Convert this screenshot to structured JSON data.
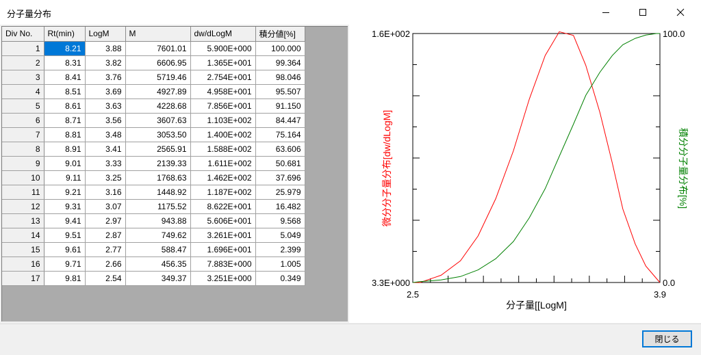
{
  "window": {
    "title": "分子量分布",
    "minimize_icon": "minimize-icon",
    "maximize_icon": "maximize-icon",
    "close_icon": "close-icon"
  },
  "table": {
    "columns": [
      "Div No.",
      "Rt(min)",
      "LogM",
      "M",
      "dw/dLogM",
      "積分値[%]"
    ],
    "rows": [
      [
        "1",
        "8.21",
        "3.88",
        "7601.01",
        "5.900E+000",
        "100.000"
      ],
      [
        "2",
        "8.31",
        "3.82",
        "6606.95",
        "1.365E+001",
        "99.364"
      ],
      [
        "3",
        "8.41",
        "3.76",
        "5719.46",
        "2.754E+001",
        "98.046"
      ],
      [
        "4",
        "8.51",
        "3.69",
        "4927.89",
        "4.958E+001",
        "95.507"
      ],
      [
        "5",
        "8.61",
        "3.63",
        "4228.68",
        "7.856E+001",
        "91.150"
      ],
      [
        "6",
        "8.71",
        "3.56",
        "3607.63",
        "1.103E+002",
        "84.447"
      ],
      [
        "7",
        "8.81",
        "3.48",
        "3053.50",
        "1.400E+002",
        "75.164"
      ],
      [
        "8",
        "8.91",
        "3.41",
        "2565.91",
        "1.588E+002",
        "63.606"
      ],
      [
        "9",
        "9.01",
        "3.33",
        "2139.33",
        "1.611E+002",
        "50.681"
      ],
      [
        "10",
        "9.11",
        "3.25",
        "1768.63",
        "1.462E+002",
        "37.696"
      ],
      [
        "11",
        "9.21",
        "3.16",
        "1448.92",
        "1.187E+002",
        "25.979"
      ],
      [
        "12",
        "9.31",
        "3.07",
        "1175.52",
        "8.622E+001",
        "16.482"
      ],
      [
        "13",
        "9.41",
        "2.97",
        "943.88",
        "5.606E+001",
        "9.568"
      ],
      [
        "14",
        "9.51",
        "2.87",
        "749.62",
        "3.261E+001",
        "5.049"
      ],
      [
        "15",
        "9.61",
        "2.77",
        "588.47",
        "1.696E+001",
        "2.399"
      ],
      [
        "16",
        "9.71",
        "2.66",
        "456.35",
        "7.883E+000",
        "1.005"
      ],
      [
        "17",
        "9.81",
        "2.54",
        "349.37",
        "3.251E+000",
        "0.349"
      ]
    ],
    "selected_row": 0,
    "selected_col": 1
  },
  "chart_data": {
    "type": "line",
    "xlabel": "分子量[[LogM]",
    "ylabel_left": "微分分子量分布[dw/dLogM]",
    "ylabel_right": "積分分子量分布[%]",
    "xlim": [
      2.5,
      3.9
    ],
    "ylim_left": [
      3.3,
      160
    ],
    "ylim_right": [
      0,
      100
    ],
    "x_tick_labels": [
      "2.5",
      "3.9"
    ],
    "y_left_tick_labels": [
      "1.6E+002",
      "3.3E+000"
    ],
    "y_right_tick_labels": [
      "100.0",
      "0.0"
    ],
    "grid": false,
    "series": [
      {
        "axis": "left",
        "color": "#ff0000",
        "x": [
          2.5,
          2.54,
          2.66,
          2.77,
          2.87,
          2.97,
          3.07,
          3.16,
          3.25,
          3.33,
          3.41,
          3.48,
          3.56,
          3.63,
          3.69,
          3.76,
          3.82,
          3.88,
          3.9
        ],
        "y": [
          3.3,
          3.251,
          7.883,
          16.96,
          32.61,
          56.06,
          86.22,
          118.7,
          146.2,
          161.1,
          158.8,
          140.0,
          110.3,
          78.56,
          49.58,
          27.54,
          13.65,
          5.9,
          3.3
        ]
      },
      {
        "axis": "right",
        "color": "#008000",
        "x": [
          2.5,
          2.54,
          2.66,
          2.77,
          2.87,
          2.97,
          3.07,
          3.16,
          3.25,
          3.33,
          3.41,
          3.48,
          3.56,
          3.63,
          3.69,
          3.76,
          3.82,
          3.88,
          3.9
        ],
        "y": [
          0.0,
          0.349,
          1.005,
          2.399,
          5.049,
          9.568,
          16.482,
          25.979,
          37.696,
          50.681,
          63.606,
          75.164,
          84.447,
          91.15,
          95.507,
          98.046,
          99.364,
          100.0,
          100.0
        ]
      }
    ]
  },
  "footer": {
    "close_label": "閉じる"
  }
}
